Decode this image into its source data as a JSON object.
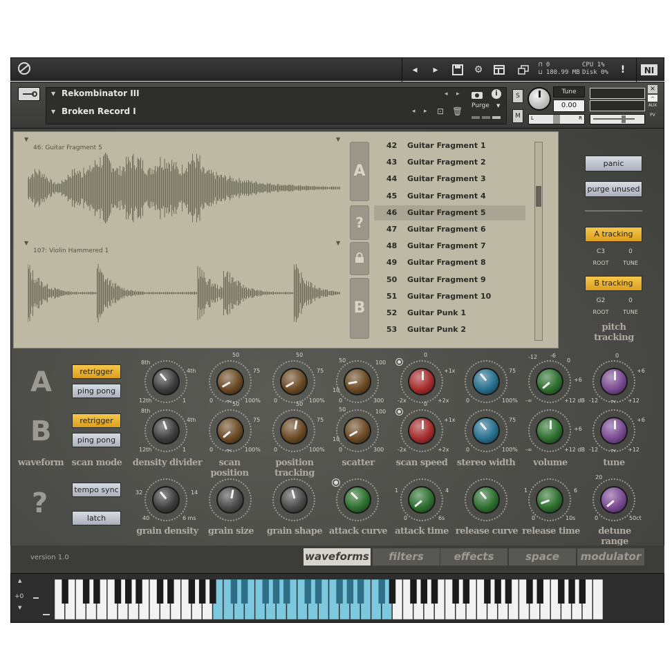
{
  "host": {
    "stats": {
      "voices": "0",
      "memory": "180.99 MB",
      "cpu_label": "CPU",
      "cpu_value": "1%",
      "disk_label": "Disk",
      "disk_value": "0%"
    }
  },
  "instrument": {
    "name": "Rekombinator III",
    "preset": "Broken Record I",
    "purge_label": "Purge",
    "tune_label": "Tune",
    "tune_value": "0.00",
    "solo_label": "S",
    "mute_label": "M",
    "pan_left": "L",
    "pan_right": "R",
    "aux_label": "AUX",
    "pv_label": "PV"
  },
  "waveforms": {
    "a_title": "46: Guitar Fragment 5",
    "b_title": "107: Violin Hammered 1"
  },
  "slots": {
    "a": "A",
    "q": "?",
    "b": "B"
  },
  "samples": [
    {
      "num": "42",
      "name": "Guitar Fragment 1"
    },
    {
      "num": "43",
      "name": "Guitar Fragment 2"
    },
    {
      "num": "44",
      "name": "Guitar Fragment 3"
    },
    {
      "num": "45",
      "name": "Guitar Fragment 4"
    },
    {
      "num": "46",
      "name": "Guitar Fragment 5"
    },
    {
      "num": "47",
      "name": "Guitar Fragment 6"
    },
    {
      "num": "48",
      "name": "Guitar Fragment 7"
    },
    {
      "num": "49",
      "name": "Guitar Fragment 8"
    },
    {
      "num": "50",
      "name": "Guitar Fragment 9"
    },
    {
      "num": "51",
      "name": "Guitar Fragment 10"
    },
    {
      "num": "52",
      "name": "Guitar Punk 1"
    },
    {
      "num": "53",
      "name": "Guitar Punk 2"
    }
  ],
  "selected_sample": "46",
  "right": {
    "panic": "panic",
    "purge_unused": "purge unused",
    "a_tracking": "A tracking",
    "b_tracking": "B tracking",
    "a_root": "C3",
    "a_tune": "0",
    "b_root": "G2",
    "b_tune": "0",
    "root_label": "ROOT",
    "tune_label": "TUNE",
    "pitch_tracking": "pitch tracking"
  },
  "controls": {
    "row_a_letter": "A",
    "row_b_letter": "B",
    "row_q_letter": "?",
    "retrigger": "retrigger",
    "ping_pong": "ping pong",
    "tempo_sync": "tempo sync",
    "latch": "latch",
    "labels": {
      "waveform": "waveform",
      "scan_mode": "scan mode",
      "density_divider": "density divider",
      "scan_position": "scan position",
      "position_tracking": "position tracking",
      "scatter": "scatter",
      "scan_speed": "scan speed",
      "stereo_width": "stereo width",
      "volume": "volume",
      "tune": "tune",
      "grain_density": "grain density",
      "grain_size": "grain size",
      "grain_shape": "grain shape",
      "attack_curve": "attack curve",
      "attack_time": "attack time",
      "release_curve": "release curve",
      "release_time": "release time",
      "detune_range": "detune range"
    },
    "ticks": {
      "dd_8th": "8th",
      "dd_4th": "4th",
      "dd_12th": "12th",
      "dd_1": "1",
      "sp_50": "50",
      "sp_75": "75",
      "sp_0": "0",
      "sp_100": "100%",
      "sp_tilde": "~",
      "pt_50": "50",
      "pt_75": "75",
      "pt_0": "0",
      "pt_100": "100%",
      "sc_50": "50",
      "sc_100": "100",
      "sc_10": "10",
      "sc_0": "0",
      "sc_300": "300",
      "ss_0": "0",
      "ss_p1": "+1x",
      "ss_m2": "-2x",
      "ss_p2": "+2x",
      "sw_75": "75",
      "sw_0": "0",
      "sw_100": "100%",
      "vo_m12": "-12",
      "vo_m6": "-6",
      "vo_0": "0",
      "vo_p6": "+6",
      "vo_minf": "-∞",
      "vo_p12": "+12 dB",
      "tu_0": "0",
      "tu_p6": "+6",
      "tu_m12": "-12",
      "tu_p12": "+12",
      "tu_tilde": "~",
      "gd_32": "32",
      "gd_14": "14",
      "gd_40": "40",
      "gd_6ms": "6 ms",
      "at_1": "1",
      "at_4": "4",
      "at_0": "0",
      "at_6s": "6s",
      "rt_1": "1",
      "rt_6": "6",
      "rt_0": "0",
      "rt_10s": "10s",
      "dr_20": "20",
      "dr_0": "0",
      "dr_50ct": "50ct"
    }
  },
  "footer": {
    "version": "version 1.0",
    "tabs": [
      "waveforms",
      "filters",
      "effects",
      "space",
      "modulator"
    ],
    "active_tab": "waveforms"
  },
  "keyboard": {
    "octave": "+0"
  },
  "colors": {
    "accent_orange": "#e8b332",
    "knob_brown": "#6a4a24",
    "knob_red": "#a52c2c",
    "knob_blue": "#27708e",
    "knob_green": "#2d6f2e",
    "knob_purple": "#7a4a92",
    "knob_gray": "#3e3e3e",
    "keyboard_active": "#7cc8de"
  }
}
